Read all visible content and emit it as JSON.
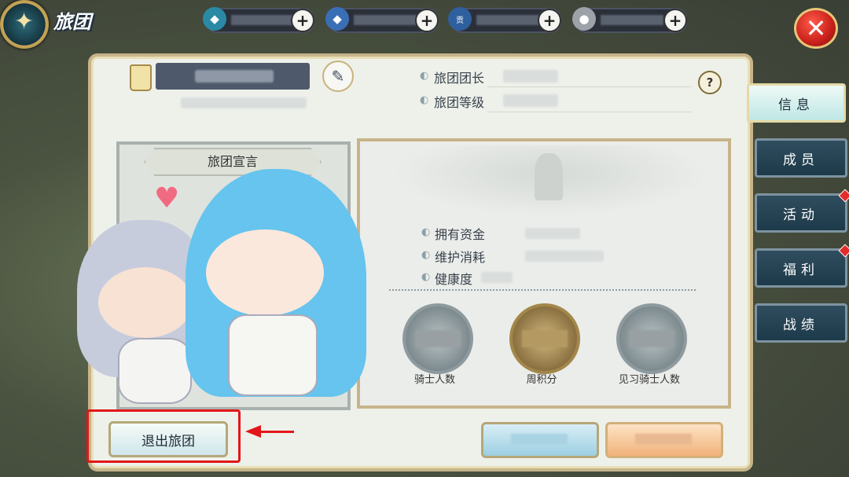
{
  "header": {
    "title": "旅团",
    "resources": [
      {
        "icon": "blue-crystal-icon",
        "glyph": "◆",
        "color": "#4cc0d8",
        "value": ""
      },
      {
        "icon": "locked-crystal-icon",
        "glyph": "◆",
        "color": "#5f9de0",
        "value": ""
      },
      {
        "icon": "contribution-coin-icon",
        "glyph": "贡献",
        "color": "#3f78c2",
        "value": ""
      },
      {
        "icon": "silver-coin-icon",
        "glyph": "●",
        "color": "#c4c8cc",
        "value": ""
      }
    ],
    "add_label": "+",
    "close_label": "✕"
  },
  "guild": {
    "leader_label": "旅团团长",
    "level_label": "旅团等级",
    "help_label": "?",
    "declaration_title": "旅团宣言"
  },
  "stats": {
    "funds_label": "拥有资金",
    "upkeep_label": "维护消耗",
    "health_label": "健康度",
    "medals": [
      {
        "label": "骑士人数",
        "tone": "silver"
      },
      {
        "label": "周积分",
        "tone": "gold"
      },
      {
        "label": "见习骑士人数",
        "tone": "silver"
      }
    ]
  },
  "buttons": {
    "leave_label": "退出旅团"
  },
  "tabs": [
    {
      "label": "信息",
      "active": true,
      "badge": false
    },
    {
      "label": "成员",
      "active": false,
      "badge": false
    },
    {
      "label": "活动",
      "active": false,
      "badge": true
    },
    {
      "label": "福利",
      "active": false,
      "badge": true
    },
    {
      "label": "战绩",
      "active": false,
      "badge": false
    }
  ],
  "colors": {
    "highlight": "#e2161a",
    "panel": "#eef1ea",
    "frame": "#c7b48a"
  }
}
